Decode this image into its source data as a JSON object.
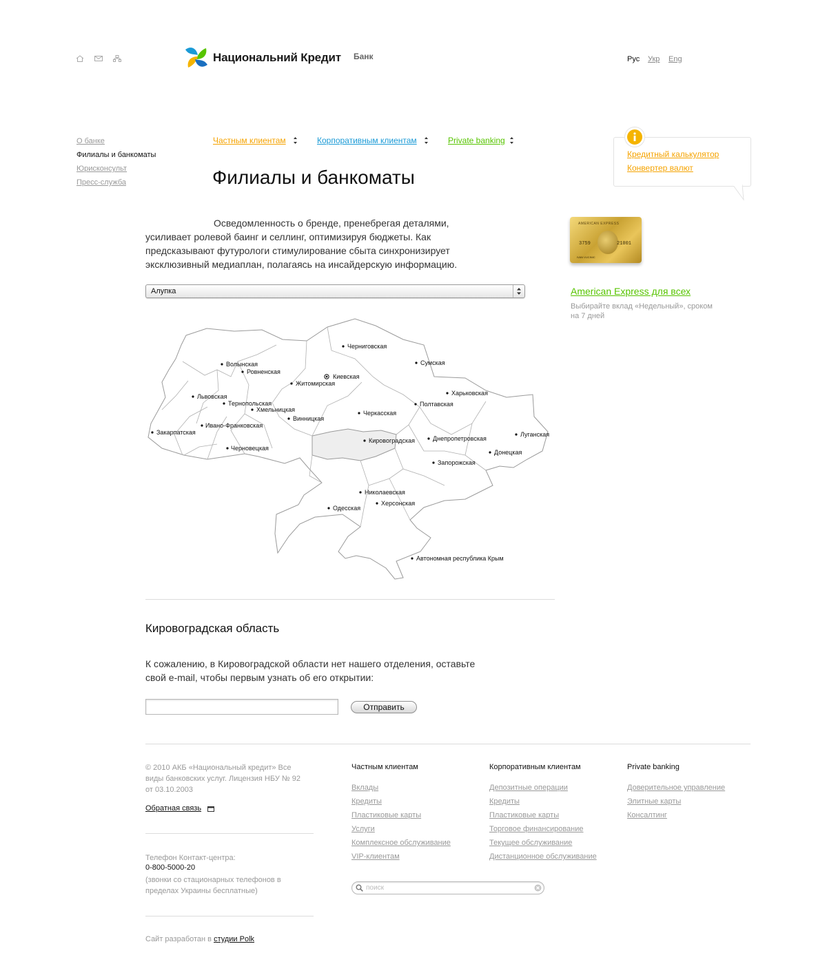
{
  "header": {
    "logo_text": "Национальний Кредит",
    "logo_sub": "Банк",
    "icons": [
      "home-icon",
      "mail-icon",
      "sitemap-icon"
    ],
    "languages": [
      {
        "label": "Рус",
        "active": true
      },
      {
        "label": "Укр",
        "active": false
      },
      {
        "label": "Eng",
        "active": false
      }
    ]
  },
  "sidebar": {
    "items": [
      {
        "label": "О банке",
        "active": false
      },
      {
        "label": "Филиалы и банкоматы",
        "active": true
      },
      {
        "label": "Юрисконсульт",
        "active": false
      },
      {
        "label": "Пресс-служба",
        "active": false
      }
    ]
  },
  "topnav": {
    "items": [
      {
        "label": "Частным клиентам",
        "color": "#f5a300"
      },
      {
        "label": "Корпоративным клиентам",
        "color": "#1a9ad6"
      },
      {
        "label": "Private banking",
        "color": "#57c400"
      }
    ]
  },
  "page": {
    "title": "Филиалы и банкоматы",
    "intro": "Осведомленность о бренде, пренебрегая деталями, усиливает ролевой баинг и селлинг, оптимизируя бюджеты. Как предсказывают футурологи стимулирование сбыта синхронизирует эксклюзивный медиаплан, полагаясь на инсайдерскую информацию.",
    "select_value": "Алупка"
  },
  "map": {
    "selected_region": "Кировоградская",
    "regions": [
      "Волынская",
      "Ровненская",
      "Житомирская",
      "Киевская",
      "Черниговская",
      "Сумская",
      "Харьковская",
      "Львовская",
      "Тернопольская",
      "Хмельницкая",
      "Винницкая",
      "Черкасская",
      "Полтавская",
      "Закарпатская",
      "Ивано-Франковская",
      "Черновецкая",
      "Кировоградская",
      "Днепропетровская",
      "Луганская",
      "Донецкая",
      "Запорожская",
      "Николаевская",
      "Херсонская",
      "Одесская",
      "Автономная республика Крым"
    ]
  },
  "region_info": {
    "title": "Кировоградская область",
    "message": "К сожалению, в Кировоградской области нет нашего отделения, оставьте свой e-mail, чтобы первым узнать об его открытии:",
    "email_value": "",
    "submit_label": "Отправить"
  },
  "right": {
    "links": [
      "Кредитный калькулятор",
      "Конвертер валют"
    ],
    "card": {
      "brand": "AMERICAN EXPRESS",
      "number_a": "3759",
      "number_b": "21001",
      "holder": "IVAN VUCINIC"
    },
    "promo_title": "American Express для всех",
    "promo_text": "Выбирайте вклад «Недельный», сроком на 7 дней"
  },
  "footer": {
    "copyright": "© 2010 АКБ «Национальный кредит» Все виды банковских услуг. Лицензия НБУ № 92 от 03.10.2003",
    "feedback": "Обратная связь",
    "phone_label": "Телефон Контакт-центра:",
    "phone": "0-800-5000-20",
    "phone_note": "(звонки со стационарных телефонов в пределах Украины бесплатные)",
    "credits_prefix": "Сайт разработан в",
    "credits_link": "студии Polk",
    "columns": [
      {
        "title": "Частным клиентам",
        "links": [
          "Вклады",
          "Кредиты",
          "Пластиковые карты",
          "Услуги",
          "Комплексное обслуживание",
          "VIP-клиентам"
        ]
      },
      {
        "title": "Корпоративным клиентам",
        "links": [
          "Депозитные операции",
          "Кредиты",
          "Пластиковые карты",
          "Торговое финансирование",
          "Текущее обслуживание",
          "Дистанционное обслуживание"
        ]
      },
      {
        "title": "Private banking",
        "links": [
          "Доверительное управление",
          "Элитные карты",
          "Консалтинг"
        ]
      }
    ],
    "search_placeholder": "поиск"
  },
  "colors": {
    "orange": "#f5a300",
    "blue": "#1a9ad6",
    "green": "#57c400"
  }
}
